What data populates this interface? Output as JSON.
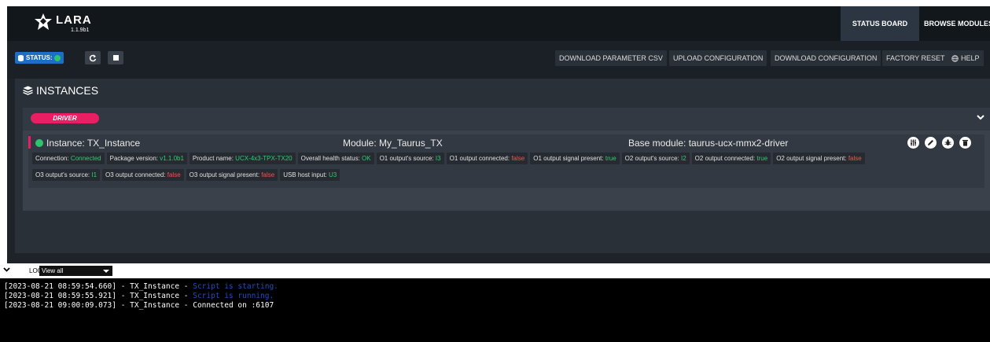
{
  "header": {
    "app_name": "LARA",
    "version": "1.1.9b1",
    "tabs": [
      {
        "label": "STATUS BOARD",
        "active": true
      },
      {
        "label": "BROWSE MODULES",
        "active": false
      }
    ]
  },
  "toolbar": {
    "status_label": "STATUS:",
    "actions": [
      "DOWNLOAD PARAMETER CSV",
      "UPLOAD CONFIGURATION",
      "DOWNLOAD CONFIGURATION",
      "FACTORY RESET",
      "HELP"
    ]
  },
  "instances": {
    "title": "INSTANCES",
    "driver_label": "DRIVER",
    "instance": {
      "name": "Instance: TX_Instance",
      "module": "Module: My_Taurus_TX",
      "base_module": "Base module: taurus-ucx-mmx2-driver",
      "tags_row1": [
        {
          "label": "Connection: ",
          "value": "Connected",
          "state": "ok"
        },
        {
          "label": "Package version: ",
          "value": "v1.1.0b1",
          "state": "ok"
        },
        {
          "label": "Product name: ",
          "value": "UCX-4x3-TPX-TX20",
          "state": "ok"
        },
        {
          "label": "Overall health status: ",
          "value": "OK",
          "state": "ok"
        },
        {
          "label": "O1 output's source: ",
          "value": "I3",
          "state": "ok"
        },
        {
          "label": "O1 output connected: ",
          "value": "false",
          "state": "bad"
        },
        {
          "label": "O1 output signal present: ",
          "value": "true",
          "state": "ok"
        },
        {
          "label": "O2 output's source: ",
          "value": "I2",
          "state": "ok"
        },
        {
          "label": "O2 output connected: ",
          "value": "true",
          "state": "ok"
        },
        {
          "label": "O2 output signal present: ",
          "value": "false",
          "state": "bad"
        }
      ],
      "tags_row2": [
        {
          "label": "O3 output's source: ",
          "value": "I1",
          "state": "ok"
        },
        {
          "label": "O3 output connected: ",
          "value": "false",
          "state": "bad"
        },
        {
          "label": "O3 output signal present: ",
          "value": "false",
          "state": "bad"
        },
        {
          "label": "USB host input: ",
          "value": "U3",
          "state": "ok"
        }
      ]
    }
  },
  "log": {
    "label": "LOG:",
    "filter": "View all",
    "lines": [
      {
        "prefix": "[2023-08-21 08:59:54.660] - TX_Instance - ",
        "message": "Script is starting.",
        "style": "info"
      },
      {
        "prefix": "[2023-08-21 08:59:55.921] - TX_Instance - ",
        "message": "Script is running.",
        "style": "info"
      },
      {
        "prefix": "[2023-08-21 09:00:09.073] - TX_Instance - ",
        "message": "Connected on :6107",
        "style": "plain"
      }
    ]
  },
  "colors": {
    "accent_pink": "#e91e63",
    "status_blue": "#1d6ec7",
    "ok_green": "#2ecc71",
    "bad_red": "#ff4d4d"
  }
}
